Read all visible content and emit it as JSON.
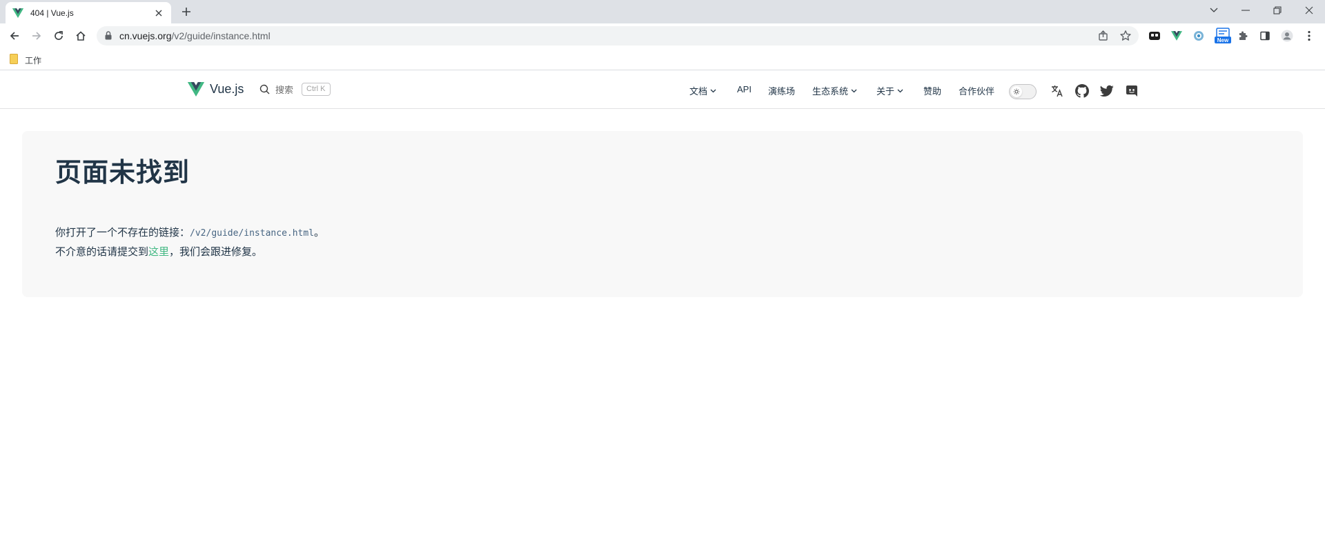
{
  "browser": {
    "tab": {
      "title": "404 | Vue.js"
    },
    "url": {
      "host": "cn.vuejs.org",
      "path": "/v2/guide/instance.html"
    },
    "extension_badge": "New",
    "bookmarks": [
      {
        "label": "工作"
      }
    ]
  },
  "site": {
    "logo_text": "Vue.js",
    "search": {
      "label": "搜索",
      "shortcut": "Ctrl K"
    },
    "nav": [
      {
        "label": "文档",
        "dropdown": true
      },
      {
        "label": "API",
        "dropdown": false
      },
      {
        "label": "演练场",
        "dropdown": false
      },
      {
        "label": "生态系统",
        "dropdown": true
      },
      {
        "label": "关于",
        "dropdown": true
      },
      {
        "label": "赞助",
        "dropdown": false
      },
      {
        "label": "合作伙伴",
        "dropdown": false
      }
    ],
    "colors": {
      "brand": "#42b883",
      "brand_dark": "#35495e",
      "text": "#213547",
      "card_bg": "#f8f8f8"
    }
  },
  "main": {
    "heading": "页面未找到",
    "line1_prefix": "你打开了一个不存在的链接：",
    "line1_code": "/v2/guide/instance.html",
    "line1_suffix": "。",
    "line2_prefix": "不介意的话请提交到",
    "line2_link": "这里",
    "line2_suffix": "，我们会跟进修复。"
  }
}
